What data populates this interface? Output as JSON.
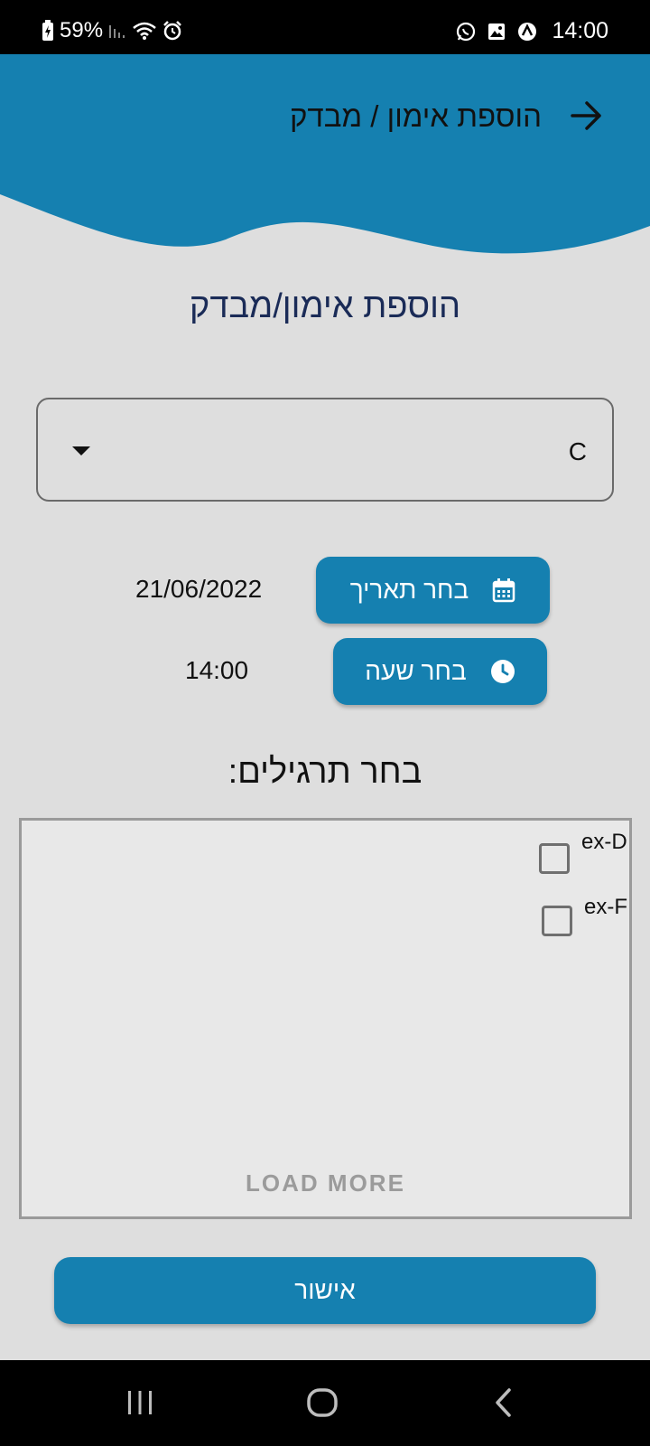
{
  "status_bar": {
    "battery": "59%",
    "time": "14:00",
    "icons": [
      "battery-charging-icon",
      "signal-icon",
      "wifi-icon",
      "alarm-icon",
      "whatsapp-icon",
      "gallery-icon",
      "notification-icon"
    ]
  },
  "header": {
    "title": "הוספת אימון / מבדק",
    "back_icon": "arrow-right-icon",
    "color": "#1580b0"
  },
  "page_title": "הוספת אימון/מבדק",
  "trainee_select": {
    "selected": "C"
  },
  "date_picker": {
    "button_label": "בחר תאריך",
    "value": "21/06/2022",
    "icon": "calendar-icon"
  },
  "time_picker": {
    "button_label": "בחר שעה",
    "value": "14:00",
    "icon": "clock-icon"
  },
  "exercises": {
    "title": "בחר תרגילים:",
    "items": [
      {
        "label": "ex-D",
        "checked": false
      },
      {
        "label": "ex-F",
        "checked": false
      }
    ],
    "load_more": "LOAD MORE"
  },
  "confirm_button": "אישור",
  "nav_bar": {
    "icons": [
      "recent-apps-icon",
      "home-icon",
      "back-icon"
    ]
  }
}
